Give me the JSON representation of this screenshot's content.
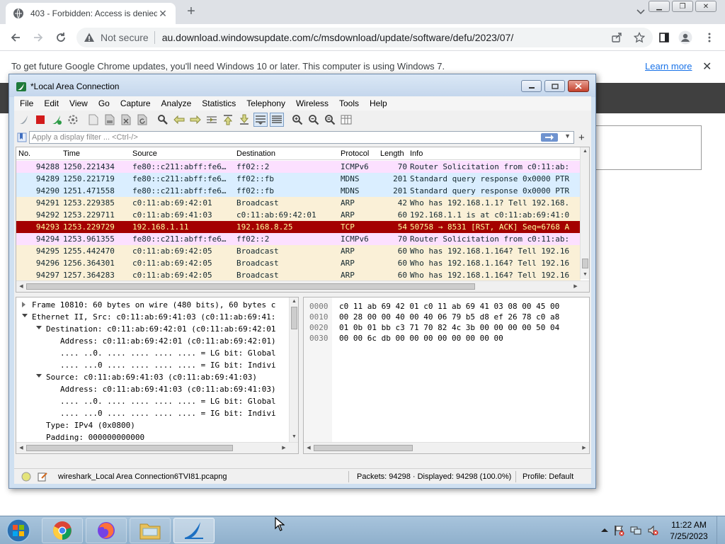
{
  "browser": {
    "tab_title": "403 - Forbidden: Access is denied.",
    "not_secure": "Not secure",
    "url": "au.download.windowsupdate.com/c/msdownload/update/software/defu/2023/07/",
    "infobar_text": "To get future Google Chrome updates, you'll need Windows 10 or later. This computer is using Windows 7.",
    "infobar_link": "Learn more"
  },
  "wireshark": {
    "title": "*Local Area Connection",
    "menu": [
      "File",
      "Edit",
      "View",
      "Go",
      "Capture",
      "Analyze",
      "Statistics",
      "Telephony",
      "Wireless",
      "Tools",
      "Help"
    ],
    "filter_placeholder": "Apply a display filter ... <Ctrl-/>",
    "columns": {
      "no": "No.",
      "time": "Time",
      "source": "Source",
      "destination": "Destination",
      "protocol": "Protocol",
      "length": "Length",
      "info": "Info"
    },
    "packets": [
      {
        "no": "94288",
        "time": "1250.221434",
        "source": "fe80::c211:abff:fe6…",
        "destination": "ff02::2",
        "protocol": "ICMPv6",
        "length": "70",
        "info": "Router Solicitation from c0:11:ab:",
        "bg": "#fce0ff",
        "fg": "#12272e"
      },
      {
        "no": "94289",
        "time": "1250.221719",
        "source": "fe80::c211:abff:fe6…",
        "destination": "ff02::fb",
        "protocol": "MDNS",
        "length": "201",
        "info": "Standard query response 0x0000 PTR",
        "bg": "#daeeff",
        "fg": "#12272e"
      },
      {
        "no": "94290",
        "time": "1251.471558",
        "source": "fe80::c211:abff:fe6…",
        "destination": "ff02::fb",
        "protocol": "MDNS",
        "length": "201",
        "info": "Standard query response 0x0000 PTR",
        "bg": "#daeeff",
        "fg": "#12272e"
      },
      {
        "no": "94291",
        "time": "1253.229385",
        "source": "c0:11:ab:69:42:01",
        "destination": "Broadcast",
        "protocol": "ARP",
        "length": "42",
        "info": "Who has 192.168.1.1? Tell 192.168.",
        "bg": "#faf0d7",
        "fg": "#12272e"
      },
      {
        "no": "94292",
        "time": "1253.229711",
        "source": "c0:11:ab:69:41:03",
        "destination": "c0:11:ab:69:42:01",
        "protocol": "ARP",
        "length": "60",
        "info": "192.168.1.1 is at c0:11:ab:69:41:0",
        "bg": "#faf0d7",
        "fg": "#12272e"
      },
      {
        "no": "94293",
        "time": "1253.229729",
        "source": "192.168.1.11",
        "destination": "192.168.8.25",
        "protocol": "TCP",
        "length": "54",
        "info": "50758 → 8531 [RST, ACK] Seq=6768 A",
        "bg": "#a40000",
        "fg": "#fffc9c"
      },
      {
        "no": "94294",
        "time": "1253.961355",
        "source": "fe80::c211:abff:fe6…",
        "destination": "ff02::2",
        "protocol": "ICMPv6",
        "length": "70",
        "info": "Router Solicitation from c0:11:ab:",
        "bg": "#fce0ff",
        "fg": "#12272e"
      },
      {
        "no": "94295",
        "time": "1255.442470",
        "source": "c0:11:ab:69:42:05",
        "destination": "Broadcast",
        "protocol": "ARP",
        "length": "60",
        "info": "Who has 192.168.1.164? Tell 192.16",
        "bg": "#faf0d7",
        "fg": "#12272e"
      },
      {
        "no": "94296",
        "time": "1256.364301",
        "source": "c0:11:ab:69:42:05",
        "destination": "Broadcast",
        "protocol": "ARP",
        "length": "60",
        "info": "Who has 192.168.1.164? Tell 192.16",
        "bg": "#faf0d7",
        "fg": "#12272e"
      },
      {
        "no": "94297",
        "time": "1257.364283",
        "source": "c0:11:ab:69:42:05",
        "destination": "Broadcast",
        "protocol": "ARP",
        "length": "60",
        "info": "Who has 192.168.1.164? Tell 192.16",
        "bg": "#faf0d7",
        "fg": "#12272e"
      },
      {
        "no": "94298",
        "time": "1261.648903",
        "source": "fe80::c211:abff:fe6…",
        "destination": "ff02::2",
        "protocol": "ICMPv6",
        "length": "70",
        "info": "Router Solicitation from c0:11:ab:",
        "bg": "#fce0ff",
        "fg": "#12272e"
      }
    ],
    "details": [
      {
        "text": "Frame 10810: 60 bytes on wire (480 bits), 60 bytes c",
        "level": 0,
        "state": "collapsed"
      },
      {
        "text": "Ethernet II, Src: c0:11:ab:69:41:03 (c0:11:ab:69:41:",
        "level": 0,
        "state": "expanded"
      },
      {
        "text": "Destination: c0:11:ab:69:42:01 (c0:11:ab:69:42:01",
        "level": 1,
        "state": "expanded"
      },
      {
        "text": "Address: c0:11:ab:69:42:01 (c0:11:ab:69:42:01)",
        "level": 2,
        "state": "none"
      },
      {
        "text": ".... ..0. .... .... .... .... = LG bit: Global",
        "level": 2,
        "state": "none"
      },
      {
        "text": ".... ...0 .... .... .... .... = IG bit: Indivi",
        "level": 2,
        "state": "none"
      },
      {
        "text": "Source: c0:11:ab:69:41:03 (c0:11:ab:69:41:03)",
        "level": 1,
        "state": "expanded"
      },
      {
        "text": "Address: c0:11:ab:69:41:03 (c0:11:ab:69:41:03)",
        "level": 2,
        "state": "none"
      },
      {
        "text": ".... ..0. .... .... .... .... = LG bit: Global",
        "level": 2,
        "state": "none"
      },
      {
        "text": ".... ...0 .... .... .... .... = IG bit: Indivi",
        "level": 2,
        "state": "none"
      },
      {
        "text": "Type: IPv4 (0x0800)",
        "level": 1,
        "state": "none"
      },
      {
        "text": "Padding: 000000000000",
        "level": 1,
        "state": "none"
      }
    ],
    "bytes": [
      {
        "offset": "0000",
        "hex": "c0 11 ab 69 42 01 c0 11  ab 69 41 03 08 00 45 00"
      },
      {
        "offset": "0010",
        "hex": "00 28 00 00 40 00 40 06  79 b5 d8 ef 26 78 c0 a8"
      },
      {
        "offset": "0020",
        "hex": "01 0b 01 bb c3 71 70 82  4c 3b 00 00 00 00 50 04"
      },
      {
        "offset": "0030",
        "hex": "00 00 6c db 00 00 00 00  00 00 00 00"
      }
    ],
    "status": {
      "file": "wireshark_Local Area Connection6TVI81.pcapng",
      "packets": "Packets: 94298 · Displayed: 94298 (100.0%)",
      "profile": "Profile: Default"
    }
  },
  "taskbar": {
    "time": "11:22 AM",
    "date": "7/25/2023"
  }
}
